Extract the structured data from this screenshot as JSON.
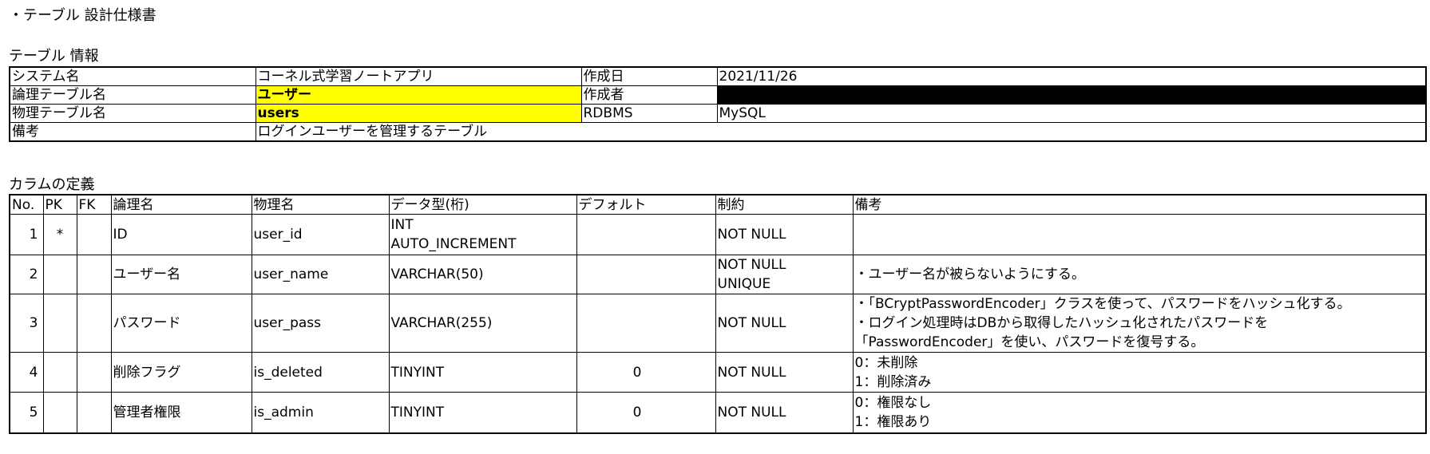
{
  "title": "・テーブル 設計仕様書",
  "info_section": {
    "label": "テーブル 情報",
    "system_name_label": "システム名",
    "system_name": "コーネル式学習ノートアプリ",
    "created_date_label": "作成日",
    "created_date": "2021/11/26",
    "logical_name_label": "論理テーブル名",
    "logical_name": "ユーザー",
    "author_label": "作成者",
    "physical_name_label": "物理テーブル名",
    "physical_name": "users",
    "rdbms_label": "RDBMS",
    "rdbms": "MySQL",
    "note_label": "備考",
    "note": "ログインユーザーを管理するテーブル"
  },
  "columns_section": {
    "label": "カラムの定義",
    "headers": [
      "No.",
      "PK",
      "FK",
      "論理名",
      "物理名",
      "データ型(桁)",
      "デフォルト",
      "制約",
      "備考"
    ],
    "rows": [
      {
        "no": "1",
        "pk": "*",
        "fk": "",
        "logical": "ID",
        "physical": "user_id",
        "type": [
          "INT",
          "AUTO_INCREMENT"
        ],
        "default": "",
        "constraint": [
          "NOT NULL"
        ],
        "note": []
      },
      {
        "no": "2",
        "pk": "",
        "fk": "",
        "logical": "ユーザー名",
        "physical": "user_name",
        "type": [
          "VARCHAR(50)"
        ],
        "default": "",
        "constraint": [
          "NOT NULL",
          "UNIQUE"
        ],
        "note": [
          "・ユーザー名が被らないようにする。"
        ]
      },
      {
        "no": "3",
        "pk": "",
        "fk": "",
        "logical": "パスワード",
        "physical": "user_pass",
        "type": [
          "VARCHAR(255)"
        ],
        "default": "",
        "constraint": [
          "NOT NULL"
        ],
        "note": [
          "・「BCryptPasswordEncoder」クラスを使って、パスワードをハッシュ化する。",
          "・ログイン処理時はDBから取得したハッシュ化されたパスワードを",
          "「PasswordEncoder」を使い、パスワードを復号する。"
        ]
      },
      {
        "no": "4",
        "pk": "",
        "fk": "",
        "logical": "削除フラグ",
        "physical": "is_deleted",
        "type": [
          "TINYINT"
        ],
        "default": "0",
        "constraint": [
          "NOT NULL"
        ],
        "note": [
          "0：未削除",
          "1：削除済み"
        ]
      },
      {
        "no": "5",
        "pk": "",
        "fk": "",
        "logical": "管理者権限",
        "physical": "is_admin",
        "type": [
          "TINYINT"
        ],
        "default": "0",
        "constraint": [
          "NOT NULL"
        ],
        "note": [
          "0：権限なし",
          "1：権限あり"
        ]
      }
    ]
  },
  "colors": {
    "highlight": "#ffff00",
    "redacted": "#000000"
  }
}
